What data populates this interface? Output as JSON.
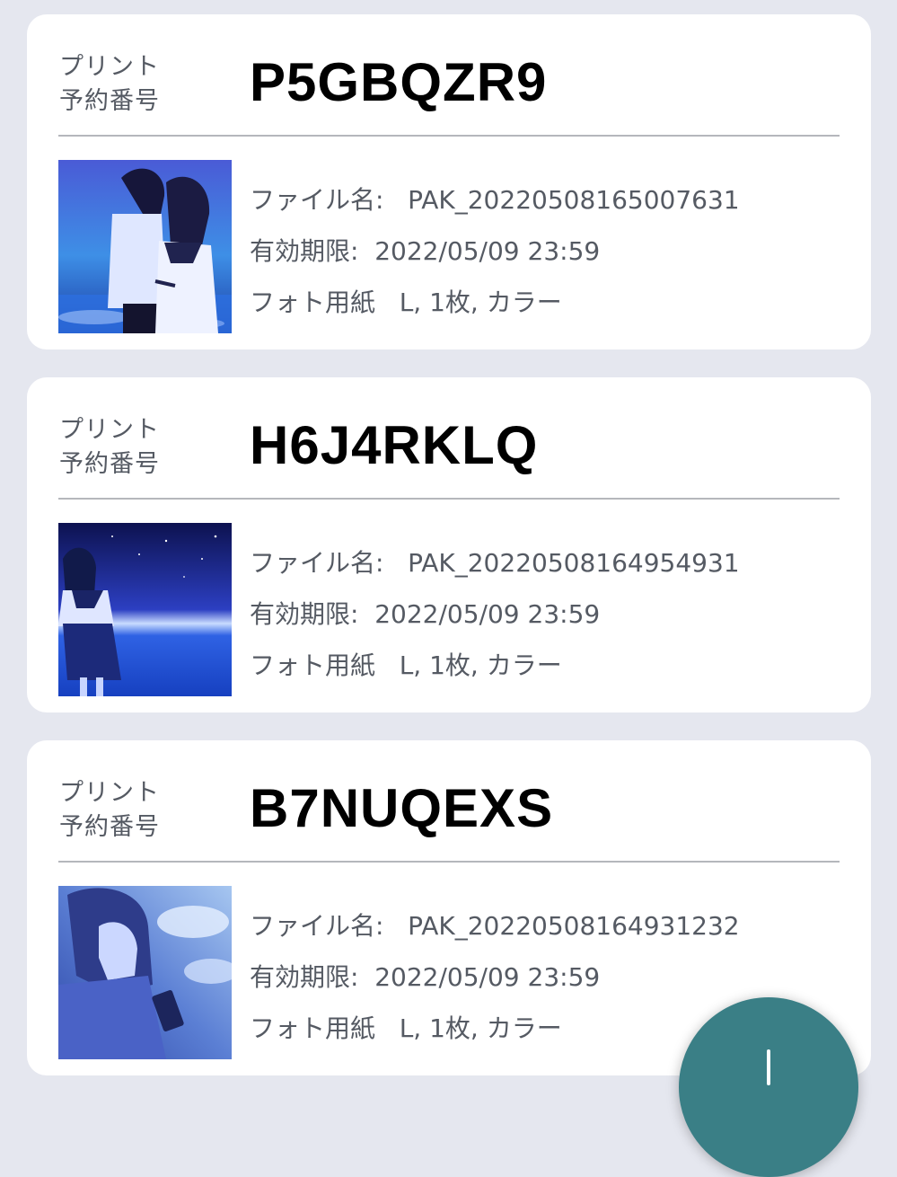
{
  "reservations": [
    {
      "label_line1": "プリント",
      "label_line2": "予約番号",
      "code": "P5GBQZR9",
      "file_row": "ファイル名:   PAK_20220508165007631",
      "expiry_row": "有効期限:  2022/05/09 23:59",
      "paper_row": "フォト用紙   L, 1枚, カラー",
      "thumbnail_icon": "anime-couple-illustration"
    },
    {
      "label_line1": "プリント",
      "label_line2": "予約番号",
      "code": "H6J4RKLQ",
      "file_row": "ファイル名:   PAK_20220508164954931",
      "expiry_row": "有効期限:  2022/05/09 23:59",
      "paper_row": "フォト用紙   L, 1枚, カラー",
      "thumbnail_icon": "anime-girl-starry-sea-illustration"
    },
    {
      "label_line1": "プリント",
      "label_line2": "予約番号",
      "code": "B7NUQEXS",
      "file_row": "ファイル名:   PAK_20220508164931232",
      "expiry_row": "有効期限:  2022/05/09 23:59",
      "paper_row": "フォト用紙   L, 1枚, カラー",
      "thumbnail_icon": "anime-girl-sky-illustration"
    }
  ],
  "fab_icon": "action-icon",
  "colors": {
    "background": "#e5e7ef",
    "card": "#ffffff",
    "code_text": "#000000",
    "secondary_text": "#555a63",
    "fab": "#3a7f86"
  }
}
